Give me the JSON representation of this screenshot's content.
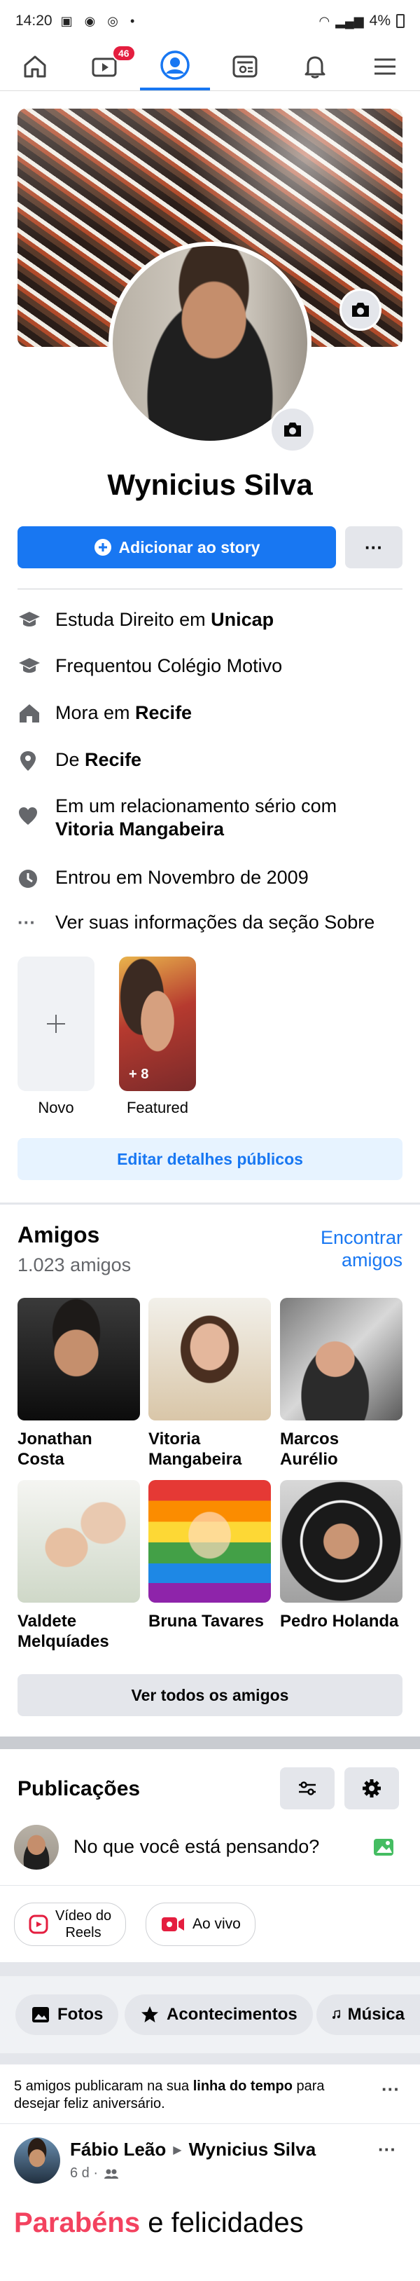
{
  "status_bar": {
    "time": "14:20",
    "battery": "4%"
  },
  "nav": {
    "video_badge": "46"
  },
  "profile": {
    "name": "Wynicius Silva",
    "add_story_label": "Adicionar ao story",
    "more_label": "···"
  },
  "details": [
    {
      "prefix": "Estuda Direito em ",
      "bold": "Unicap",
      "icon": "graduation-icon"
    },
    {
      "prefix": "Frequentou Colégio Motivo",
      "bold": "",
      "icon": "graduation-icon"
    },
    {
      "prefix": "Mora em ",
      "bold": "Recife",
      "icon": "home-icon"
    },
    {
      "prefix": "De ",
      "bold": "Recife",
      "icon": "location-pin-icon"
    },
    {
      "prefix": "Em um relacionamento sério com",
      "bold": "Vitoria Mangabeira",
      "icon": "heart-icon"
    },
    {
      "prefix": "Entrou em Novembro de 2009",
      "bold": "",
      "icon": "clock-icon"
    },
    {
      "prefix": "Ver suas informações da seção Sobre",
      "bold": "",
      "icon": "ellipsis-icon"
    }
  ],
  "highlights": {
    "new_label": "Novo",
    "featured_label": "Featured",
    "featured_count": "+ 8"
  },
  "edit_public_details": "Editar detalhes públicos",
  "friends": {
    "title": "Amigos",
    "count": "1.023 amigos",
    "find_link": "Encontrar amigos",
    "find_line1": "Encontrar",
    "find_line2": "amigos",
    "list": [
      {
        "line1": "Jonathan",
        "line2": "Costa"
      },
      {
        "line1": "Vitoria",
        "line2": "Mangabeira"
      },
      {
        "line1": "Marcos",
        "line2": "Aurélio"
      },
      {
        "line1": "Valdete",
        "line2": "Melquíades"
      },
      {
        "line1": "Bruna Tavares",
        "line2": ""
      },
      {
        "line1": "Pedro Holanda",
        "line2": ""
      }
    ],
    "see_all": "Ver todos os amigos"
  },
  "posts": {
    "title": "Publicações",
    "composer_placeholder": "No que você está pensando?",
    "reels_line1": "Vídeo do",
    "reels_line2": "Reels",
    "live_label": "Ao vivo"
  },
  "tabs": [
    "Fotos",
    "Acontecimentos",
    "Música"
  ],
  "birthday_notice": {
    "text_before": "5 amigos publicaram na sua ",
    "text_bold": "linha do tempo",
    "text_after": " para",
    "line2": "desejar feliz aniversário."
  },
  "post": {
    "author": "Fábio Leão",
    "arrow": "▶",
    "target": "Wynicius Silva",
    "time": "6 d ·",
    "text_highlight": "Parabéns",
    "text_rest": " e felicidades"
  },
  "colors": {
    "accent": "#1877f2",
    "highlight_text": "#f3425f",
    "badge": "#e41e3f"
  }
}
